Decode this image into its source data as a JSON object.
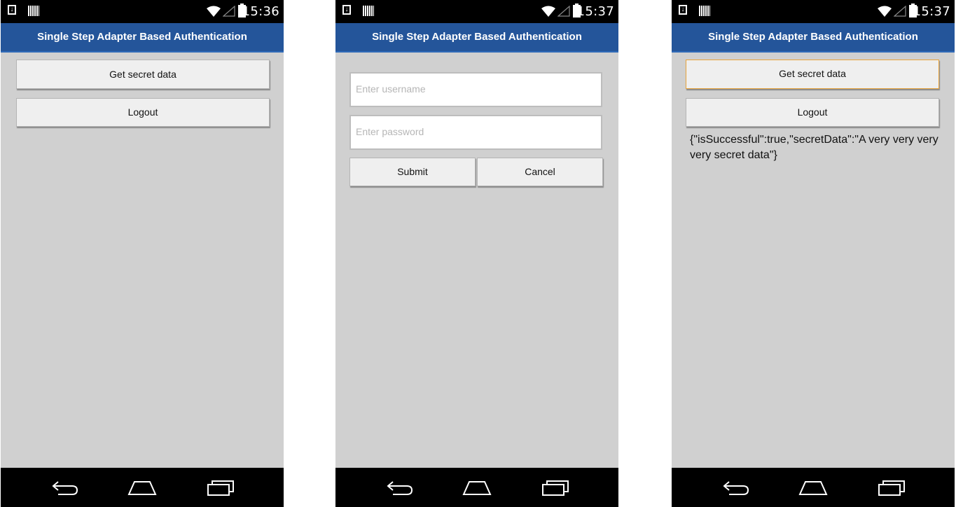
{
  "phones": [
    {
      "status_time": "15:36",
      "title": "Single Step Adapter Based Authentication",
      "get_secret_label": "Get secret data",
      "logout_label": "Logout"
    },
    {
      "status_time": "15:37",
      "title": "Single Step Adapter Based Authentication",
      "username_placeholder": "Enter username",
      "password_placeholder": "Enter password",
      "submit_label": "Submit",
      "cancel_label": "Cancel"
    },
    {
      "status_time": "15:37",
      "title": "Single Step Adapter Based Authentication",
      "get_secret_label": "Get secret data",
      "logout_label": "Logout",
      "result": "{\"isSuccessful\":true,\"secretData\":\"A very very very very secret data\"}"
    }
  ],
  "icons": {
    "status": [
      "download-icon",
      "barcode-icon",
      "wifi-icon",
      "signal-icon",
      "battery-charging-icon"
    ],
    "nav": [
      "back-icon",
      "home-icon",
      "recent-apps-icon"
    ]
  },
  "colors": {
    "titlebar": "#24559a",
    "background": "#d0d0d0",
    "focus_border": "#e7a33c"
  }
}
